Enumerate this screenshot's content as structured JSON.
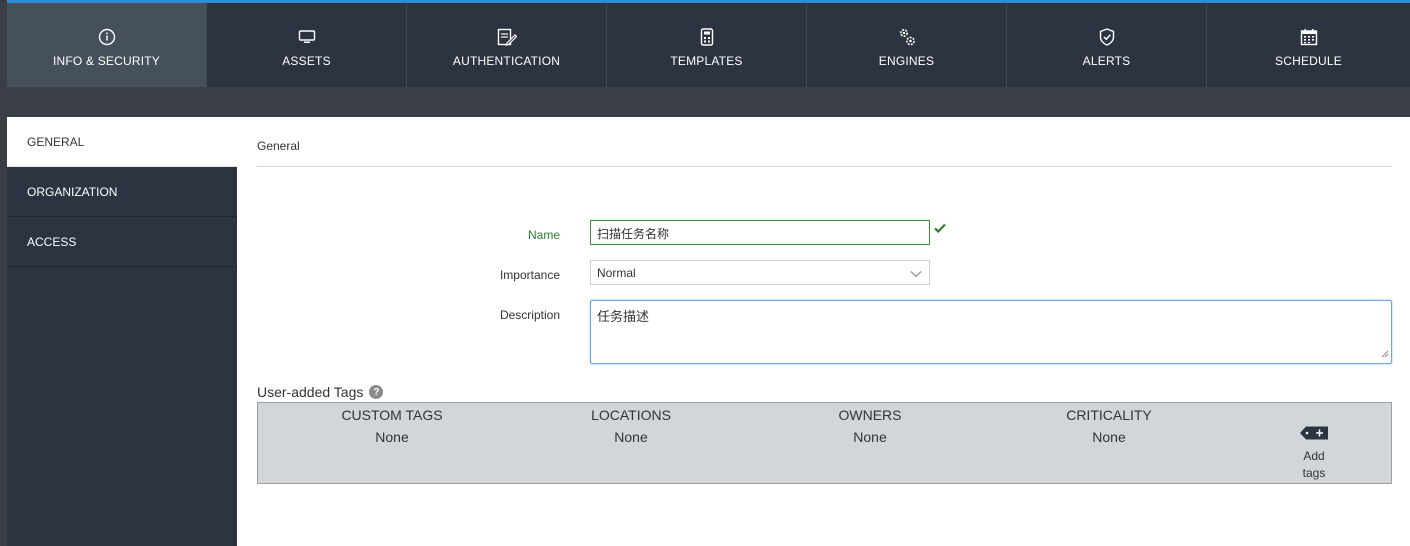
{
  "top_tabs": [
    {
      "label": "INFO & SECURITY",
      "icon": "info-circle-icon"
    },
    {
      "label": "ASSETS",
      "icon": "monitor-icon"
    },
    {
      "label": "AUTHENTICATION",
      "icon": "edit-document-icon"
    },
    {
      "label": "TEMPLATES",
      "icon": "calculator-icon"
    },
    {
      "label": "ENGINES",
      "icon": "gears-icon"
    },
    {
      "label": "ALERTS",
      "icon": "shield-check-icon"
    },
    {
      "label": "SCHEDULE",
      "icon": "calendar-icon"
    }
  ],
  "sidebar": {
    "items": [
      {
        "label": "GENERAL"
      },
      {
        "label": "ORGANIZATION"
      },
      {
        "label": "ACCESS"
      }
    ]
  },
  "general": {
    "section_title": "General",
    "name_label": "Name",
    "name_value": "扫描任务名称",
    "importance_label": "Importance",
    "importance_value": "Normal",
    "description_label": "Description",
    "description_value": "任务描述"
  },
  "tags": {
    "title": "User-added Tags",
    "help_glyph": "?",
    "columns": [
      {
        "header": "CUSTOM TAGS",
        "value": "None"
      },
      {
        "header": "LOCATIONS",
        "value": "None"
      },
      {
        "header": "OWNERS",
        "value": "None"
      },
      {
        "header": "CRITICALITY",
        "value": "None"
      }
    ],
    "add_label_1": "Add",
    "add_label_2": "tags"
  },
  "colors": {
    "nav_bg": "#2b3440",
    "nav_active": "#46505c",
    "accent_top": "#2a8fd6",
    "valid_green": "#2e7d32",
    "tags_bg": "#d3d6d9"
  }
}
